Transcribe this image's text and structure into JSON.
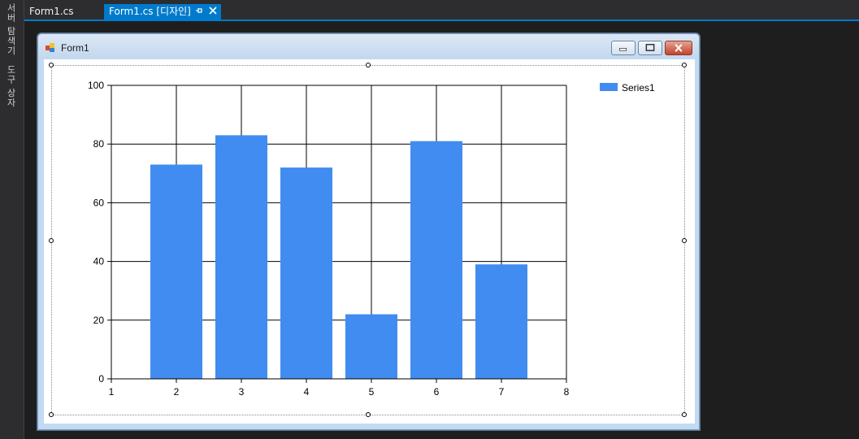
{
  "side_panel": {
    "label1": "서버 탐색기",
    "label2": "도구 상자"
  },
  "tabs": [
    {
      "label": "Form1.cs",
      "active": false
    },
    {
      "label": "Form1.cs [디자인]",
      "active": true
    }
  ],
  "icons": {
    "pin": "pin-icon",
    "close": "close-icon",
    "form": "form-icon"
  },
  "form": {
    "title": "Form1",
    "buttons": [
      "minimize",
      "maximize",
      "close"
    ]
  },
  "colors": {
    "accent": "#007acc",
    "bar": "#418cf0",
    "ide_background": "#2d2d30"
  },
  "chart_data": {
    "type": "bar",
    "x": [
      2,
      3,
      4,
      5,
      6,
      7
    ],
    "values": [
      73,
      83,
      72,
      22,
      81,
      39
    ],
    "series": [
      {
        "name": "Series1",
        "values": [
          73,
          83,
          72,
          22,
          81,
          39
        ]
      }
    ],
    "xlim": [
      1,
      8
    ],
    "ylim": [
      0,
      100
    ],
    "x_ticks": [
      "1",
      "2",
      "3",
      "4",
      "5",
      "6",
      "7",
      "8"
    ],
    "y_ticks": [
      "0",
      "20",
      "40",
      "60",
      "80",
      "100"
    ],
    "grid": true,
    "legend_position": "top-right",
    "title": "",
    "xlabel": "",
    "ylabel": ""
  }
}
